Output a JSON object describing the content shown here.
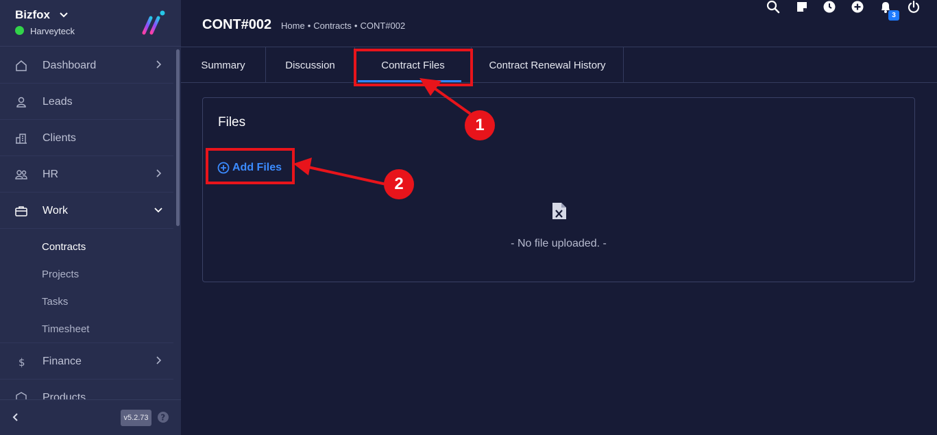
{
  "brand": {
    "name": "Bizfox",
    "user": "Harveyteck",
    "status_color": "#32d34a"
  },
  "nav": [
    {
      "label": "Dashboard",
      "icon": "home-icon",
      "arrow": "right"
    },
    {
      "label": "Leads",
      "icon": "user-icon",
      "arrow": ""
    },
    {
      "label": "Clients",
      "icon": "building-icon",
      "arrow": ""
    },
    {
      "label": "HR",
      "icon": "users-icon",
      "arrow": "right"
    },
    {
      "label": "Work",
      "icon": "briefcase-icon",
      "arrow": "down",
      "active": true
    },
    {
      "label": "Finance",
      "icon": "dollar-icon",
      "arrow": "right"
    },
    {
      "label": "Products",
      "icon": "cube-icon",
      "arrow": ""
    }
  ],
  "work_submenu": [
    "Contracts",
    "Projects",
    "Tasks",
    "Timesheet"
  ],
  "footer": {
    "version": "v5.2.73"
  },
  "header": {
    "title": "CONT#002",
    "breadcrumb": [
      "Home",
      "•",
      "Contracts",
      "•",
      "CONT#002"
    ],
    "notification_count": "3"
  },
  "tabs": [
    "Summary",
    "Discussion",
    "Contract Files",
    "Contract Renewal History"
  ],
  "active_tab": "Contract Files",
  "files": {
    "title": "Files",
    "add_label": "Add Files",
    "empty_text": "- No file uploaded. -"
  },
  "annotations": {
    "step1": "1",
    "step2": "2",
    "color": "#e8141b"
  },
  "colors": {
    "accent": "#2f86ff",
    "sidebar": "#272d4d",
    "background": "#171b36"
  }
}
